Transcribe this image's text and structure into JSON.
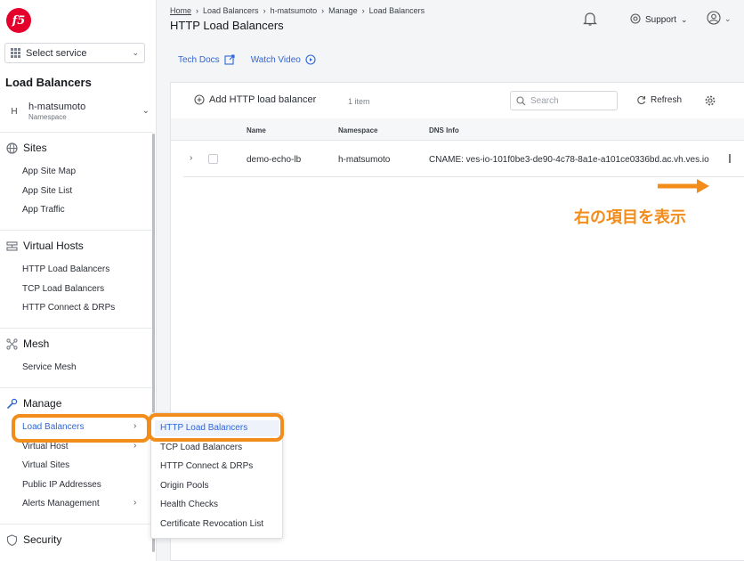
{
  "sidebar": {
    "service_select": "Select service",
    "workspace_title": "Load Balancers",
    "namespace": {
      "avatar": "H",
      "name": "h-matsumoto",
      "label": "Namespace"
    },
    "groups": [
      {
        "title": "Sites",
        "items": [
          "App Site Map",
          "App Site List",
          "App Traffic"
        ]
      },
      {
        "title": "Virtual Hosts",
        "items": [
          "HTTP Load Balancers",
          "TCP Load Balancers",
          "HTTP Connect & DRPs"
        ]
      },
      {
        "title": "Mesh",
        "items": [
          "Service Mesh"
        ]
      },
      {
        "title": "Manage",
        "items": [
          "Load Balancers",
          "Virtual Host",
          "Virtual Sites",
          "Public IP Addresses",
          "Alerts Management"
        ]
      },
      {
        "title": "Security",
        "items": []
      }
    ]
  },
  "header": {
    "breadcrumb": [
      "Home",
      "Load Balancers",
      "h-matsumoto",
      "Manage",
      "Load Balancers"
    ],
    "title": "HTTP Load Balancers",
    "support_label": "Support"
  },
  "links": {
    "tech_docs": "Tech Docs",
    "watch_video": "Watch Video"
  },
  "toolbar": {
    "add_label": "Add HTTP load balancer",
    "count": "1 item",
    "search_placeholder": "Search",
    "refresh_label": "Refresh"
  },
  "table": {
    "columns": [
      "Name",
      "Namespace",
      "DNS Info"
    ],
    "rows": [
      {
        "name": "demo-echo-lb",
        "namespace": "h-matsumoto",
        "dns": "CNAME: ves-io-101f0be3-de90-4c78-8a1e-a101ce0336bd.ac.vh.ves.io"
      }
    ]
  },
  "submenu": {
    "items": [
      "HTTP Load Balancers",
      "TCP Load Balancers",
      "HTTP Connect & DRPs",
      "Origin Pools",
      "Health Checks",
      "Certificate Revocation List"
    ]
  },
  "annotation": {
    "text": "右の項目を表示",
    "color": "#f28c1b"
  },
  "colors": {
    "accent": "#2e66d8",
    "brand": "#e4002b",
    "highlight": "#f28c1b"
  }
}
